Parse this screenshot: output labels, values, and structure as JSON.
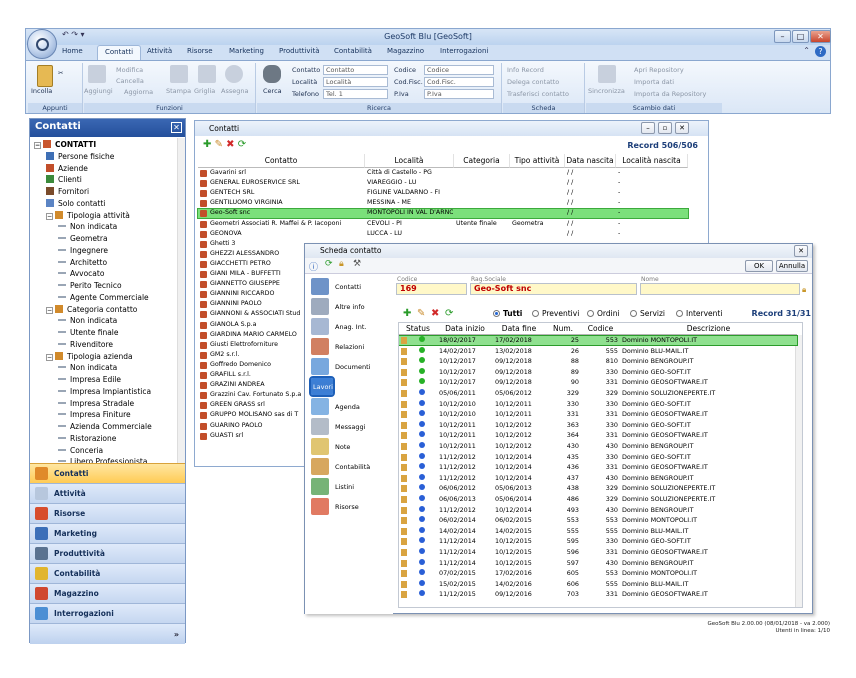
{
  "app": {
    "title": "GeoSoft Blu [GeoSoft]"
  },
  "menu": {
    "tabs": [
      "Home",
      "Contatti",
      "Attività",
      "Risorse",
      "Marketing",
      "Produttività",
      "Contabilità",
      "Magazzino",
      "Interrogazioni"
    ],
    "active": "Contatti"
  },
  "ribbon": {
    "appunti": {
      "label": "Appunti",
      "incolla": "Incolla"
    },
    "funzioni": {
      "label": "Funzioni",
      "aggiungi": "Aggiungi",
      "modifica": "Modifica",
      "cancella": "Cancella",
      "aggiorna": "Aggiorna",
      "stampa": "Stampa",
      "griglia": "Griglia",
      "assegna": "Assegna"
    },
    "ricerca": {
      "label": "Ricerca",
      "cerca": "Cerca",
      "contatto_label": "Contatto",
      "contatto_ph": "Contatto",
      "localita_label": "Località",
      "localita_ph": "Località",
      "telefono_label": "Telefono",
      "telefono_ph": "Tel. 1",
      "codice_label": "Codice",
      "codice_ph": "Codice",
      "codfisc_label": "Cod.Fisc.",
      "codfisc_ph": "Cod.Fisc.",
      "piva_label": "P.Iva",
      "piva_ph": "P.Iva"
    },
    "scheda": {
      "label": "Scheda",
      "info": "Info Record",
      "delega": "Delega contatto",
      "trasferisci": "Trasferisci contatto"
    },
    "scambio": {
      "label": "Scambio dati",
      "sincronizza": "Sincronizza",
      "apri": "Apri Repository",
      "importa": "Importa dati",
      "importa_repo": "Importa da Repository"
    }
  },
  "left_panel": {
    "title": "Contatti",
    "tree": [
      {
        "label": "CONTATTI",
        "level": 0,
        "bold": true,
        "icon": "contacts-icon",
        "exp": "−"
      },
      {
        "label": "Persone fisiche",
        "level": 1,
        "icon": "person-icon"
      },
      {
        "label": "Aziende",
        "level": 1,
        "icon": "company-icon"
      },
      {
        "label": "Clienti",
        "level": 1,
        "icon": "client-icon"
      },
      {
        "label": "Fornitori",
        "level": 1,
        "icon": "supplier-icon"
      },
      {
        "label": "Solo contatti",
        "level": 1,
        "icon": "contact-icon"
      },
      {
        "label": "Tipologia attività",
        "level": 1,
        "icon": "category-icon",
        "exp": "−"
      },
      {
        "label": "Non indicata",
        "level": 2,
        "icon": "sub-icon"
      },
      {
        "label": "Geometra",
        "level": 2,
        "icon": "sub-icon"
      },
      {
        "label": "Ingegnere",
        "level": 2,
        "icon": "sub-icon"
      },
      {
        "label": "Architetto",
        "level": 2,
        "icon": "sub-icon"
      },
      {
        "label": "Avvocato",
        "level": 2,
        "icon": "sub-icon"
      },
      {
        "label": "Perito Tecnico",
        "level": 2,
        "icon": "sub-icon"
      },
      {
        "label": "Agente Commerciale",
        "level": 2,
        "icon": "sub-icon"
      },
      {
        "label": "Categoria contatto",
        "level": 1,
        "icon": "category-icon",
        "exp": "−"
      },
      {
        "label": "Non indicata",
        "level": 2,
        "icon": "sub-icon"
      },
      {
        "label": "Utente finale",
        "level": 2,
        "icon": "sub-icon"
      },
      {
        "label": "Rivenditore",
        "level": 2,
        "icon": "sub-icon"
      },
      {
        "label": "Tipologia azienda",
        "level": 1,
        "icon": "category-icon",
        "exp": "−"
      },
      {
        "label": "Non indicata",
        "level": 2,
        "icon": "sub-icon"
      },
      {
        "label": "Impresa Edile",
        "level": 2,
        "icon": "sub-icon"
      },
      {
        "label": "Impresa Impiantistica",
        "level": 2,
        "icon": "sub-icon"
      },
      {
        "label": "Impresa Stradale",
        "level": 2,
        "icon": "sub-icon"
      },
      {
        "label": "Impresa Finiture",
        "level": 2,
        "icon": "sub-icon"
      },
      {
        "label": "Azienda Commerciale",
        "level": 2,
        "icon": "sub-icon"
      },
      {
        "label": "Ristorazione",
        "level": 2,
        "icon": "sub-icon"
      },
      {
        "label": "Conceria",
        "level": 2,
        "icon": "sub-icon"
      },
      {
        "label": "Libero Professionista",
        "level": 2,
        "icon": "sub-icon"
      }
    ],
    "nav": [
      "Contatti",
      "Attività",
      "Risorse",
      "Marketing",
      "Produttività",
      "Contabilità",
      "Magazzino",
      "Interrogazioni"
    ],
    "nav_icons": [
      "#e08a2a",
      "#b7c7dd",
      "#d74d2d",
      "#3c6fb8",
      "#5a7290",
      "#e1b52e",
      "#d0472f",
      "#4c8fd4"
    ],
    "nav_bottom": "»"
  },
  "contatti": {
    "title": "Contatti",
    "record": "Record 506/506",
    "columns": [
      "Contatto",
      "Località",
      "Categoria",
      "Tipo attività",
      "Data nascita",
      "Località nascita"
    ],
    "rows": [
      [
        "Gavarini srl",
        "Città di Castello - PG",
        "",
        "",
        "/ /",
        "-"
      ],
      [
        "GENERAL EUROSERVICE SRL",
        "VIAREGGIO - LU",
        "",
        "",
        "/ /",
        "-"
      ],
      [
        "GENTECH SRL",
        "FIGLINE VALDARNO - FI",
        "",
        "",
        "/ /",
        "-"
      ],
      [
        "GENTILUOMO VIRGINIA",
        "MESSINA - ME",
        "",
        "",
        "/ /",
        "-"
      ],
      [
        "Geo-Soft snc",
        "MONTOPOLI IN VAL D'ARNO",
        "",
        "",
        "/ /",
        "-"
      ],
      [
        "Geometri Associati R. Maffei & P. Iacoponi",
        "CEVOLI - PI",
        "Utente finale",
        "Geometra",
        "/ /",
        "-"
      ],
      [
        "GEONOVA",
        "LUCCA - LU",
        "",
        "",
        "/ /",
        "-"
      ],
      [
        "Ghetti 3",
        "",
        "",
        "",
        "",
        ""
      ],
      [
        "GHEZZI ALESSANDRO",
        "",
        "",
        "",
        "",
        ""
      ],
      [
        "GIACCHETTI PETRO",
        "",
        "",
        "",
        "",
        ""
      ],
      [
        "GIANI MILA - BUFFETTI",
        "",
        "",
        "",
        "",
        ""
      ],
      [
        "GIANNETTO GIUSEPPE",
        "",
        "",
        "",
        "",
        ""
      ],
      [
        "GIANNINI RICCARDO",
        "",
        "",
        "",
        "",
        ""
      ],
      [
        "GIANNINI PAOLO",
        "",
        "",
        "",
        "",
        ""
      ],
      [
        "GIANNONI & ASSOCIATI Stud",
        "",
        "",
        "",
        "",
        ""
      ],
      [
        "GIANOLA S.p.a",
        "",
        "",
        "",
        "",
        ""
      ],
      [
        "GIARDINA MARIO CARMELO",
        "",
        "",
        "",
        "",
        ""
      ],
      [
        "Giusti Elettroforniture",
        "",
        "",
        "",
        "",
        ""
      ],
      [
        "GM2 s.r.l.",
        "",
        "",
        "",
        "",
        ""
      ],
      [
        "Goffredo Domenico",
        "",
        "",
        "",
        "",
        ""
      ],
      [
        "GRAFILL s.r.l.",
        "",
        "",
        "",
        "",
        ""
      ],
      [
        "GRAZINI ANDREA",
        "",
        "",
        "",
        "",
        ""
      ],
      [
        "Grazzini Cav. Fortunato S.p.a",
        "",
        "",
        "",
        "",
        ""
      ],
      [
        "GREEN GRASS srl",
        "",
        "",
        "",
        "",
        ""
      ],
      [
        "GRUPPO MOLISANO sas di T",
        "",
        "",
        "",
        "",
        ""
      ],
      [
        "GUARINO PAOLO",
        "",
        "",
        "",
        "",
        ""
      ],
      [
        "GUASTI srl",
        "",
        "",
        "",
        "",
        ""
      ]
    ],
    "selected_index": 4
  },
  "scheda": {
    "title": "Scheda contatto",
    "ok": "OK",
    "annulla": "Annulla",
    "codice_label": "Codice",
    "codice": "169",
    "rag_label": "Rag.Sociale",
    "rag": "Geo-Soft snc",
    "nome_label": "Nome",
    "nome": "",
    "nav": [
      "Contatti",
      "Altre info",
      "Anag. Int.",
      "Relazioni",
      "Documenti",
      "Lavori",
      "Agenda",
      "Messaggi",
      "Note",
      "Contabilità",
      "Listini",
      "Risorse"
    ],
    "nav_active": "Lavori",
    "filters": [
      "Tutti",
      "Preventivi",
      "Ordini",
      "Servizi",
      "Interventi"
    ],
    "filter_active": "Tutti",
    "record": "Record 31/31",
    "columns": [
      "Status",
      "Data inizio",
      "Data fine",
      "Num.",
      "Codice",
      "Descrizione"
    ],
    "rows": [
      [
        "green",
        "18/02/2017",
        "17/02/2018",
        "25",
        "553",
        "Dominio MONTOPOLI.IT"
      ],
      [
        "green",
        "14/02/2017",
        "13/02/2018",
        "26",
        "555",
        "Dominio BLU-MAIL.IT"
      ],
      [
        "green",
        "10/12/2017",
        "09/12/2018",
        "88",
        "810",
        "Dominio BENGROUP.IT"
      ],
      [
        "green",
        "10/12/2017",
        "09/12/2018",
        "89",
        "330",
        "Dominio GEO-SOFT.IT"
      ],
      [
        "green",
        "10/12/2017",
        "09/12/2018",
        "90",
        "331",
        "Dominio GEOSOFTWARE.IT"
      ],
      [
        "blue",
        "05/06/2011",
        "05/06/2012",
        "329",
        "329",
        "Dominio SOLUZIONEPERTE.IT"
      ],
      [
        "blue",
        "10/12/2010",
        "10/12/2011",
        "330",
        "330",
        "Dominio GEO-SOFT.IT"
      ],
      [
        "blue",
        "10/12/2010",
        "10/12/2011",
        "331",
        "331",
        "Dominio GEOSOFTWARE.IT"
      ],
      [
        "blue",
        "10/12/2011",
        "10/12/2012",
        "363",
        "330",
        "Dominio GEO-SOFT.IT"
      ],
      [
        "blue",
        "10/12/2011",
        "10/12/2012",
        "364",
        "331",
        "Dominio GEOSOFTWARE.IT"
      ],
      [
        "blue",
        "10/12/2011",
        "10/12/2012",
        "430",
        "430",
        "Dominio BENGROUP.IT"
      ],
      [
        "blue",
        "11/12/2012",
        "10/12/2014",
        "435",
        "330",
        "Dominio GEO-SOFT.IT"
      ],
      [
        "blue",
        "11/12/2012",
        "10/12/2014",
        "436",
        "331",
        "Dominio GEOSOFTWARE.IT"
      ],
      [
        "blue",
        "11/12/2012",
        "10/12/2014",
        "437",
        "430",
        "Dominio BENGROUP.IT"
      ],
      [
        "blue",
        "06/06/2012",
        "05/06/2013",
        "438",
        "329",
        "Dominio SOLUZIONEPERTE.IT"
      ],
      [
        "blue",
        "06/06/2013",
        "05/06/2014",
        "486",
        "329",
        "Dominio SOLUZIONEPERTE.IT"
      ],
      [
        "blue",
        "11/12/2012",
        "10/12/2014",
        "493",
        "430",
        "Dominio BENGROUP.IT"
      ],
      [
        "blue",
        "06/02/2014",
        "06/02/2015",
        "553",
        "553",
        "Dominio MONTOPOLI.IT"
      ],
      [
        "blue",
        "14/02/2014",
        "14/02/2015",
        "555",
        "555",
        "Dominio BLU-MAIL.IT"
      ],
      [
        "blue",
        "11/12/2014",
        "10/12/2015",
        "595",
        "330",
        "Dominio GEO-SOFT.IT"
      ],
      [
        "blue",
        "11/12/2014",
        "10/12/2015",
        "596",
        "331",
        "Dominio GEOSOFTWARE.IT"
      ],
      [
        "blue",
        "11/12/2014",
        "10/12/2015",
        "597",
        "430",
        "Dominio BENGROUP.IT"
      ],
      [
        "blue",
        "07/02/2015",
        "17/02/2016",
        "605",
        "553",
        "Dominio MONTOPOLI.IT"
      ],
      [
        "blue",
        "15/02/2015",
        "14/02/2016",
        "606",
        "555",
        "Dominio BLU-MAIL.IT"
      ],
      [
        "blue",
        "11/12/2015",
        "09/12/2016",
        "703",
        "331",
        "Dominio GEOSOFTWARE.IT"
      ]
    ],
    "selected_index": 0
  },
  "status": {
    "line1": "GeoSoft Blu 2.00.00 (08/01/2018 - va 2.000)",
    "line2": "Utenti in linea: 1/10"
  }
}
